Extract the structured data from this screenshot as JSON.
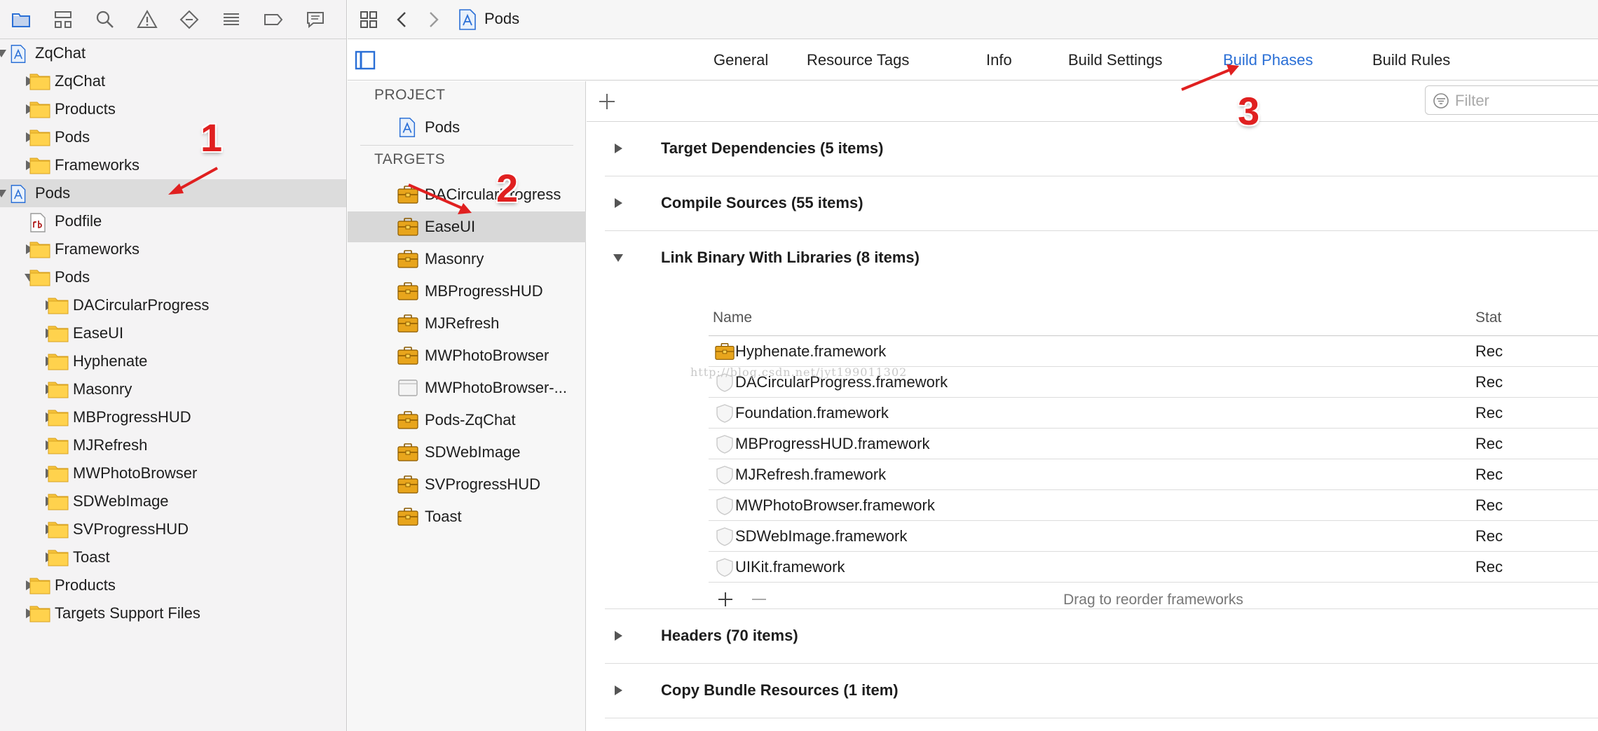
{
  "colors": {
    "accent": "#2a6fd6",
    "folder": "#f5c23a",
    "annotation": "#e02020",
    "target_icon": "#e8a51c"
  },
  "navigator": {
    "toolbar_icons": [
      "folder-icon",
      "hierarchy-icon",
      "search-icon",
      "warning-icon",
      "test-icon",
      "debug-icon",
      "breakpoint-icon",
      "report-icon"
    ],
    "tree": [
      {
        "label": "ZqChat",
        "icon": "project",
        "indent": 0,
        "disclosure": "open-small",
        "selected": false
      },
      {
        "label": "ZqChat",
        "icon": "folder",
        "indent": 1,
        "disclosure": "closed",
        "selected": false
      },
      {
        "label": "Products",
        "icon": "folder",
        "indent": 1,
        "disclosure": "closed",
        "selected": false
      },
      {
        "label": "Pods",
        "icon": "folder",
        "indent": 1,
        "disclosure": "closed",
        "selected": false
      },
      {
        "label": "Frameworks",
        "icon": "folder",
        "indent": 1,
        "disclosure": "closed",
        "selected": false
      },
      {
        "label": "Pods",
        "icon": "project",
        "indent": 0,
        "disclosure": "open-small",
        "selected": true
      },
      {
        "label": "Podfile",
        "icon": "ruby",
        "indent": 1,
        "disclosure": "none",
        "selected": false
      },
      {
        "label": "Frameworks",
        "icon": "folder",
        "indent": 1,
        "disclosure": "closed",
        "selected": false
      },
      {
        "label": "Pods",
        "icon": "folder",
        "indent": 1,
        "disclosure": "open",
        "selected": false
      },
      {
        "label": "DACircularProgress",
        "icon": "folder",
        "indent": 2,
        "disclosure": "closed",
        "selected": false
      },
      {
        "label": "EaseUI",
        "icon": "folder",
        "indent": 2,
        "disclosure": "closed",
        "selected": false
      },
      {
        "label": "Hyphenate",
        "icon": "folder",
        "indent": 2,
        "disclosure": "closed",
        "selected": false
      },
      {
        "label": "Masonry",
        "icon": "folder",
        "indent": 2,
        "disclosure": "closed",
        "selected": false
      },
      {
        "label": "MBProgressHUD",
        "icon": "folder",
        "indent": 2,
        "disclosure": "closed",
        "selected": false
      },
      {
        "label": "MJRefresh",
        "icon": "folder",
        "indent": 2,
        "disclosure": "closed",
        "selected": false
      },
      {
        "label": "MWPhotoBrowser",
        "icon": "folder",
        "indent": 2,
        "disclosure": "closed",
        "selected": false
      },
      {
        "label": "SDWebImage",
        "icon": "folder",
        "indent": 2,
        "disclosure": "closed",
        "selected": false
      },
      {
        "label": "SVProgressHUD",
        "icon": "folder",
        "indent": 2,
        "disclosure": "closed",
        "selected": false
      },
      {
        "label": "Toast",
        "icon": "folder",
        "indent": 2,
        "disclosure": "closed",
        "selected": false
      },
      {
        "label": "Products",
        "icon": "folder",
        "indent": 1,
        "disclosure": "closed",
        "selected": false
      },
      {
        "label": "Targets Support Files",
        "icon": "folder",
        "indent": 1,
        "disclosure": "closed",
        "selected": false
      }
    ]
  },
  "topbar": {
    "jump_title": "Pods"
  },
  "tabs": [
    {
      "label": "General",
      "active": false
    },
    {
      "label": "Resource Tags",
      "active": false
    },
    {
      "label": "Info",
      "active": false
    },
    {
      "label": "Build Settings",
      "active": false
    },
    {
      "label": "Build Phases",
      "active": true
    },
    {
      "label": "Build Rules",
      "active": false
    }
  ],
  "target_list": {
    "project_header": "PROJECT",
    "project_item": "Pods",
    "targets_header": "TARGETS",
    "targets": [
      {
        "label": "DACircularProgress",
        "icon": "target",
        "selected": false
      },
      {
        "label": "EaseUI",
        "icon": "target",
        "selected": true
      },
      {
        "label": "Masonry",
        "icon": "target",
        "selected": false
      },
      {
        "label": "MBProgressHUD",
        "icon": "target",
        "selected": false
      },
      {
        "label": "MJRefresh",
        "icon": "target",
        "selected": false
      },
      {
        "label": "MWPhotoBrowser",
        "icon": "target",
        "selected": false
      },
      {
        "label": "MWPhotoBrowser-...",
        "icon": "bundle",
        "selected": false
      },
      {
        "label": "Pods-ZqChat",
        "icon": "target",
        "selected": false
      },
      {
        "label": "SDWebImage",
        "icon": "target",
        "selected": false
      },
      {
        "label": "SVProgressHUD",
        "icon": "target",
        "selected": false
      },
      {
        "label": "Toast",
        "icon": "target",
        "selected": false
      }
    ]
  },
  "phase_editor": {
    "filter_placeholder": "Filter",
    "phases": [
      {
        "title": "Target Dependencies (5 items)",
        "expanded": false
      },
      {
        "title": "Compile Sources (55 items)",
        "expanded": false
      },
      {
        "title": "Link Binary With Libraries (8 items)",
        "expanded": true
      },
      {
        "title": "Headers (70 items)",
        "expanded": false
      },
      {
        "title": "Copy Bundle Resources (1 item)",
        "expanded": false
      }
    ],
    "libraries": {
      "col_name": "Name",
      "col_status": "Stat",
      "rows": [
        {
          "name": "Hyphenate.framework",
          "icon": "target",
          "status": "Rec"
        },
        {
          "name": "DACircularProgress.framework",
          "icon": "framework",
          "status": "Rec"
        },
        {
          "name": "Foundation.framework",
          "icon": "framework",
          "status": "Rec"
        },
        {
          "name": "MBProgressHUD.framework",
          "icon": "framework",
          "status": "Rec"
        },
        {
          "name": "MJRefresh.framework",
          "icon": "framework",
          "status": "Rec"
        },
        {
          "name": "MWPhotoBrowser.framework",
          "icon": "framework",
          "status": "Rec"
        },
        {
          "name": "SDWebImage.framework",
          "icon": "framework",
          "status": "Rec"
        },
        {
          "name": "UIKit.framework",
          "icon": "framework",
          "status": "Rec"
        }
      ],
      "drag_hint": "Drag to reorder frameworks"
    },
    "watermark": "http://blog.csdn.net/jyt199011302"
  },
  "annotations": [
    {
      "number": "1"
    },
    {
      "number": "2"
    },
    {
      "number": "3"
    }
  ]
}
